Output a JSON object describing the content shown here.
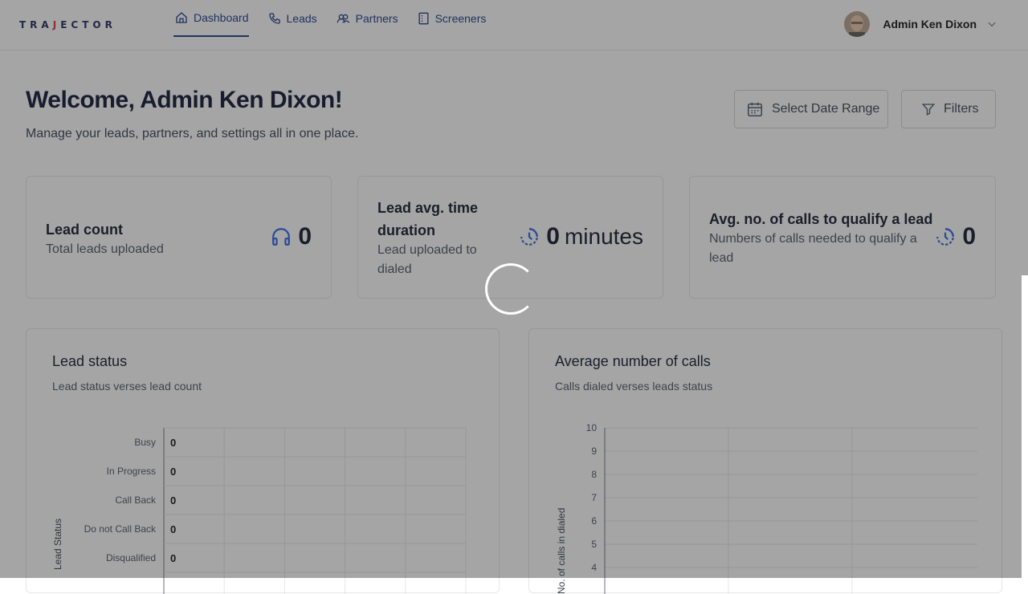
{
  "nav": {
    "logo": "TRAJECTOR",
    "items": [
      {
        "label": "Dashboard",
        "icon": "home-icon",
        "active": true
      },
      {
        "label": "Leads",
        "icon": "phone-icon"
      },
      {
        "label": "Partners",
        "icon": "users-icon"
      },
      {
        "label": "Screeners",
        "icon": "clipboard-icon"
      }
    ],
    "user_name": "Admin Ken Dixon"
  },
  "header": {
    "welcome": "Welcome, Admin Ken Dixon!",
    "subtitle": "Manage your leads, partners, and settings all in one place.",
    "date_range_label": "Select Date Range",
    "filters_label": "Filters"
  },
  "stats": [
    {
      "title": "Lead count",
      "description": "Total leads uploaded",
      "value": "0",
      "unit": "",
      "icon": "headphones-icon"
    },
    {
      "title": "Lead avg. time duration",
      "description": "Lead uploaded to dialed",
      "value": "0",
      "unit": "minutes",
      "icon": "clock-icon"
    },
    {
      "title": "Avg. no. of calls to qualify a lead",
      "description": "Numbers of calls needed to qualify a lead",
      "value": "0",
      "unit": "",
      "icon": "clock-icon"
    }
  ],
  "chart_data": [
    {
      "type": "bar",
      "title": "Lead status",
      "subtitle": "Lead status verses lead count",
      "orientation": "horizontal",
      "ylabel": "Lead Status",
      "categories": [
        "Busy",
        "In Progress",
        "Call Back",
        "Do not Call Back",
        "Disqualified"
      ],
      "values": [
        0,
        0,
        0,
        0,
        0
      ],
      "grid": true
    },
    {
      "type": "bar",
      "title": "Average number of calls",
      "subtitle": "Calls dialed verses leads status",
      "ylabel": "No. of calls in dialed",
      "y_ticks": [
        "10",
        "9",
        "8",
        "7",
        "6",
        "5",
        "4"
      ],
      "ylim": [
        0,
        10
      ],
      "grid": true
    }
  ],
  "colors": {
    "accent": "#1d3a8a",
    "icon_blue": "#2563eb"
  }
}
